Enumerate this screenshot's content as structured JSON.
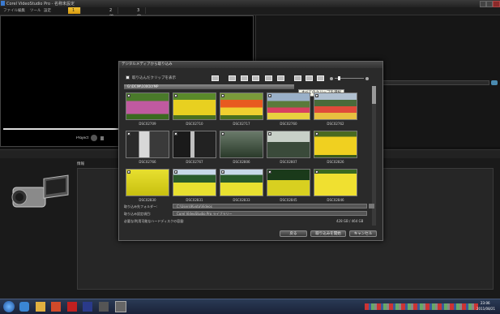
{
  "window": {
    "title": "Corel VideoStudio Pro - 名称未設定"
  },
  "menu": {
    "items": [
      "ファイル",
      "編集",
      "ツール",
      "設定"
    ]
  },
  "steps": [
    {
      "label": "1 キャプチャー",
      "active": true
    },
    {
      "label": "2 編集",
      "active": false
    },
    {
      "label": "3 完了",
      "active": false
    }
  ],
  "player": {
    "project_label": "Project"
  },
  "lower_panel": {
    "info_label": "情報"
  },
  "dialog": {
    "title": "デジタルメディアから取り込み",
    "show_imported_label": "取り込んだクリップを表示",
    "tooltip": "すべてのクリップを選択",
    "path": "G:\\DCIM\\100OLYMP",
    "thumbnails": [
      {
        "caption": "DSC02709",
        "palette": "tulips-pink"
      },
      {
        "caption": "DSC02710",
        "palette": "tulips-yellow"
      },
      {
        "caption": "DSC02717",
        "palette": "tulips-red"
      },
      {
        "caption": "DSC02760",
        "palette": "field-mixed"
      },
      {
        "caption": "DSC02762",
        "palette": "field-red"
      },
      {
        "caption": "DSC02766",
        "palette": "waterfall"
      },
      {
        "caption": "DSC02767",
        "palette": "waterfall-dark"
      },
      {
        "caption": "DSC02806",
        "palette": "forest"
      },
      {
        "caption": "DSC02807",
        "palette": "trees"
      },
      {
        "caption": "DSC02826",
        "palette": "tulips-yellow2"
      },
      {
        "caption": "DSC02830",
        "palette": "rapeseed"
      },
      {
        "caption": "DSC02831",
        "palette": "rapeseed-trees"
      },
      {
        "caption": "DSC02833",
        "palette": "rapeseed-trees"
      },
      {
        "caption": "DSC02845",
        "palette": "rapeseed-field"
      },
      {
        "caption": "DSC02846",
        "palette": "rapeseed2"
      }
    ],
    "import_folder_label": "取り込み先フォルダー:",
    "import_folder_value": "C:\\Users\\Kyoto\\Videos",
    "import_settings_label": "取り込み設定項目:",
    "import_settings_value": "Corel VideoStudio Pro ライブラリー",
    "disk_space_label": "必要な/利用可能なハードディスクの容量:",
    "disk_space_value": "428 GB / 464 GB",
    "buttons": {
      "back": "戻る",
      "start": "取り込みを開始",
      "cancel": "キャンセル"
    }
  },
  "taskbar": {
    "time": "23:06",
    "date": "2011/08/21"
  }
}
